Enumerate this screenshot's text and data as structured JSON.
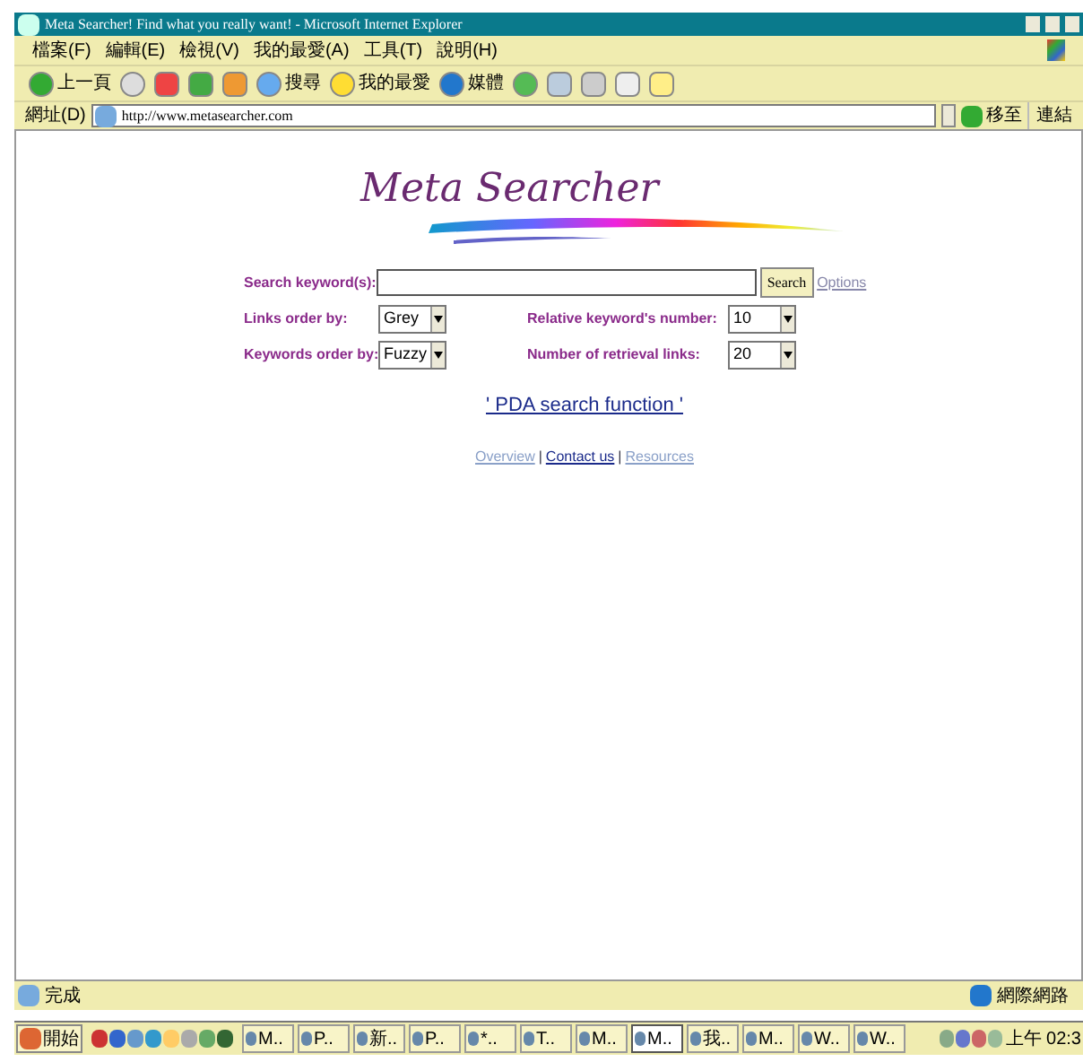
{
  "window": {
    "title": "Meta Searcher! Find what you really want! - Microsoft Internet Explorer"
  },
  "menu": [
    "檔案(F)",
    "編輯(E)",
    "檢視(V)",
    "我的最愛(A)",
    "工具(T)",
    "說明(H)"
  ],
  "toolbar": {
    "back": "上一頁",
    "search": "搜尋",
    "favorites": "我的最愛",
    "media": "媒體"
  },
  "address": {
    "label": "網址(D)",
    "value": "http://www.metasearcher.com",
    "go": "移至",
    "links": "連結"
  },
  "page": {
    "logo": "Meta Searcher",
    "search_label": "Search keyword(s):",
    "search_button": "Search",
    "options_link": "Options",
    "fields": [
      {
        "label": "Links order by:",
        "value": "Grey"
      },
      {
        "label": "Relative keyword's number:",
        "value": "10"
      },
      {
        "label": "Keywords order by:",
        "value": "Fuzzy"
      },
      {
        "label": "Number of retrieval links:",
        "value": "20"
      }
    ],
    "pda_link": "' PDA search function '",
    "separator": "|",
    "footer_links": [
      {
        "label": "Overview",
        "visited": true
      },
      {
        "label": "Contact us",
        "visited": false
      },
      {
        "label": "Resources",
        "visited": true
      }
    ]
  },
  "status_bar": {
    "text": "完成",
    "zone": "網際網路"
  },
  "taskbar": {
    "start": "開始",
    "buttons": [
      {
        "label": "M..",
        "selected": false
      },
      {
        "label": "P..",
        "selected": false
      },
      {
        "label": "新..",
        "selected": false
      },
      {
        "label": "P..",
        "selected": false
      },
      {
        "label": "*..",
        "selected": false
      },
      {
        "label": "T..",
        "selected": false
      },
      {
        "label": "M..",
        "selected": false
      },
      {
        "label": "M..",
        "selected": true
      },
      {
        "label": "我..",
        "selected": false
      },
      {
        "label": "M..",
        "selected": false
      },
      {
        "label": "W..",
        "selected": false
      },
      {
        "label": "W..",
        "selected": false
      }
    ],
    "clock": "上午 02:3"
  }
}
